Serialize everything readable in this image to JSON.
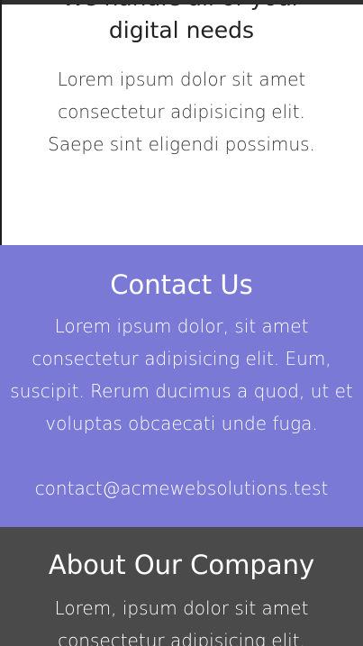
{
  "hero": {
    "heading": "We handle all of your digital needs",
    "text": "Lorem ipsum dolor sit amet consectetur adipisicing elit. Saepe sint eligendi possimus."
  },
  "contact": {
    "heading": "Contact Us",
    "text": "Lorem ipsum dolor, sit amet consectetur adipisicing elit. Eum, suscipit. Rerum ducimus a quod, ut et voluptas obcaecati unde fuga.",
    "email": "contact@acmewebsolutions.test"
  },
  "about": {
    "heading": "About Our Company",
    "text": "Lorem, ipsum dolor sit amet consectetur adipisicing elit."
  },
  "colors": {
    "contact_bg": "#7a7ad6",
    "about_bg": "#4a4a4a",
    "hero_bg": "#ffffff"
  }
}
